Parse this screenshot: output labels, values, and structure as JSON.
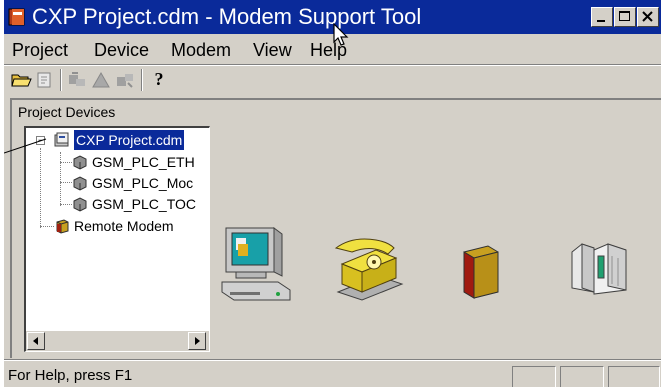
{
  "window": {
    "title": "CXP Project.cdm - Modem Support Tool",
    "titlebar_color": "#0a2a9a",
    "chrome_color": "#d4d0c8"
  },
  "menu": {
    "items": [
      {
        "label": "Project"
      },
      {
        "label": "Device"
      },
      {
        "label": "Modem"
      },
      {
        "label": "View"
      },
      {
        "label": "Help"
      }
    ]
  },
  "toolbar": {
    "icons": [
      "open-folder-icon",
      "properties-icon",
      "connect-icon",
      "modem-warning-icon",
      "disconnect-icon",
      "help-icon"
    ],
    "help_glyph": "?"
  },
  "panel": {
    "title": "Project Devices"
  },
  "tree": {
    "root": {
      "label": "CXP Project.cdm",
      "icon": "project-icon",
      "expander": "−"
    },
    "children": [
      {
        "label": "GSM_PLC_ETH",
        "icon": "plc-device-icon"
      },
      {
        "label": "GSM_PLC_Moc",
        "icon": "plc-device-icon"
      },
      {
        "label": "GSM_PLC_TOC",
        "icon": "plc-device-icon"
      }
    ],
    "remote": {
      "label": "Remote Modem",
      "icon": "remote-modem-icon"
    }
  },
  "devices": [
    {
      "name": "computer-icon"
    },
    {
      "name": "telephone-icon"
    },
    {
      "name": "modem-box-icon"
    },
    {
      "name": "plc-rack-icon"
    }
  ],
  "status": {
    "text": "For Help, press F1"
  }
}
